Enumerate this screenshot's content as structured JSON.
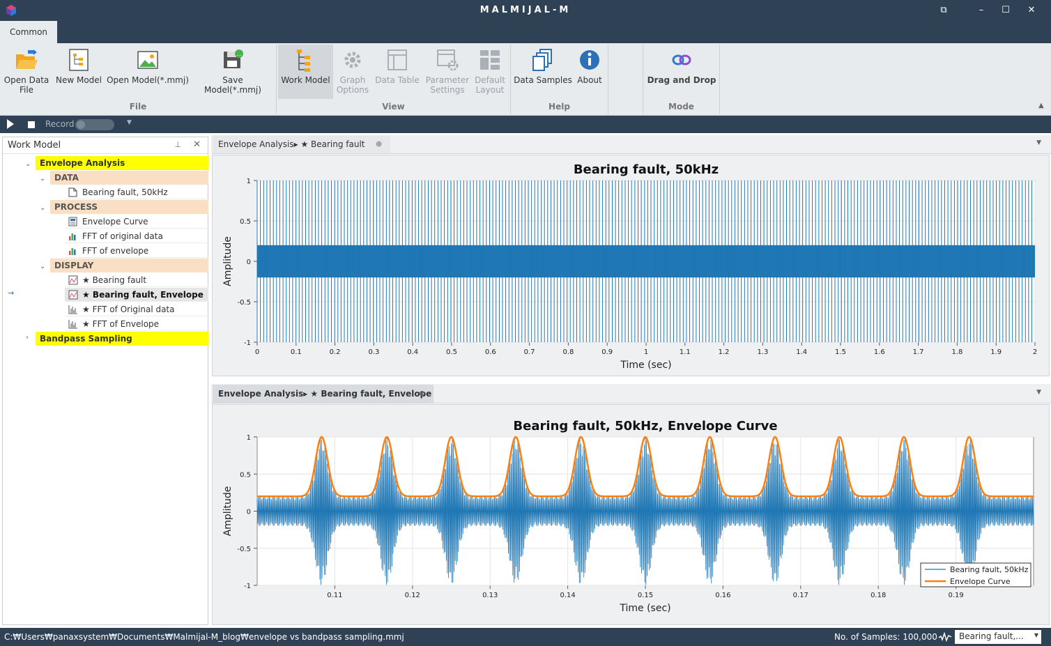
{
  "window": {
    "title": "MALMIJAL-M"
  },
  "ribbon": {
    "tab": "Common",
    "groups": {
      "file": "File",
      "view": "View",
      "help": "Help",
      "mode": "Mode"
    },
    "buttons": {
      "open_data_1": "Open Data",
      "open_data_2": "File",
      "new_model": "New Model",
      "open_model": "Open Model(*.mmj)",
      "save_model": "Save Model(*.mmj)",
      "work_model": "Work Model",
      "graph_options_1": "Graph",
      "graph_options_2": "Options",
      "data_table": "Data Table",
      "param_1": "Parameter",
      "param_2": "Settings",
      "default_1": "Default",
      "default_2": "Layout",
      "data_samples": "Data Samples",
      "about": "About",
      "drag_drop": "Drag and Drop"
    }
  },
  "toolbar": {
    "record_label": "Record"
  },
  "sidebar": {
    "title": "Work Model",
    "tree": {
      "root1": "Envelope Analysis",
      "data_cat": "DATA",
      "data_item": "Bearing fault, 50kHz",
      "process_cat": "PROCESS",
      "process_items": [
        "Envelope Curve",
        "FFT of original data",
        "FFT of envelope"
      ],
      "display_cat": "DISPLAY",
      "display_items": [
        "★ Bearing fault",
        "★ Bearing fault, Envelope",
        "★ FFT of Original data",
        "★ FFT of Envelope"
      ],
      "root2": "Bandpass Sampling"
    }
  },
  "tabs": {
    "top": "Envelope Analysis▸ ★ Bearing fault",
    "bottom": "Envelope Analysis▸ ★ Bearing fault, Envelope"
  },
  "chart_data": [
    {
      "type": "line",
      "title": "Bearing fault, 50kHz",
      "xlabel": "Time (sec)",
      "ylabel": "Amplitude",
      "xlim": [
        0,
        2
      ],
      "ylim": [
        -1,
        1
      ],
      "xticks": [
        "0",
        "0.1",
        "0.2",
        "0.3",
        "0.4",
        "0.5",
        "0.6",
        "0.7",
        "0.8",
        "0.9",
        "1",
        "1.1",
        "1.2",
        "1.3",
        "1.4",
        "1.5",
        "1.6",
        "1.7",
        "1.8",
        "1.9",
        "2"
      ],
      "yticks": [
        "1",
        "0.5",
        "0",
        "-0.5",
        "-1"
      ],
      "grid": true,
      "series_color": "#1f77b4",
      "impulse_period_sec": 0.0083,
      "baseline_amplitude": 0.2,
      "peak_amplitude": 1
    },
    {
      "type": "line",
      "title": "Bearing fault, 50kHz, Envelope Curve",
      "xlabel": "Time (sec)",
      "ylabel": "Amplitude",
      "xlim": [
        0.1,
        0.2
      ],
      "ylim": [
        -1,
        1
      ],
      "xticks": [
        "0.11",
        "0.12",
        "0.13",
        "0.14",
        "0.15",
        "0.16",
        "0.17",
        "0.18",
        "0.19"
      ],
      "yticks": [
        "1",
        "0.5",
        "0",
        "-0.5",
        "-1"
      ],
      "grid": true,
      "legend_position": "bottom-right",
      "series": [
        {
          "name": "Bearing fault, 50kHz",
          "color": "#1f77b4"
        },
        {
          "name": "Envelope Curve",
          "color": "#ff7f0e"
        }
      ],
      "peak_times": [
        0.1083,
        0.1167,
        0.125,
        0.1333,
        0.1417,
        0.15,
        0.1583,
        0.1667,
        0.175,
        0.1833,
        0.1917
      ],
      "baseline_amplitude": 0.2,
      "peak_amplitude": 1
    }
  ],
  "status": {
    "path": "C:₩Users₩panaxsystem₩Documents₩Malmijal-M_blog₩envelope vs bandpass sampling.mmj",
    "samples": "No. of Samples: 100,000",
    "combo": "Bearing fault,..."
  }
}
